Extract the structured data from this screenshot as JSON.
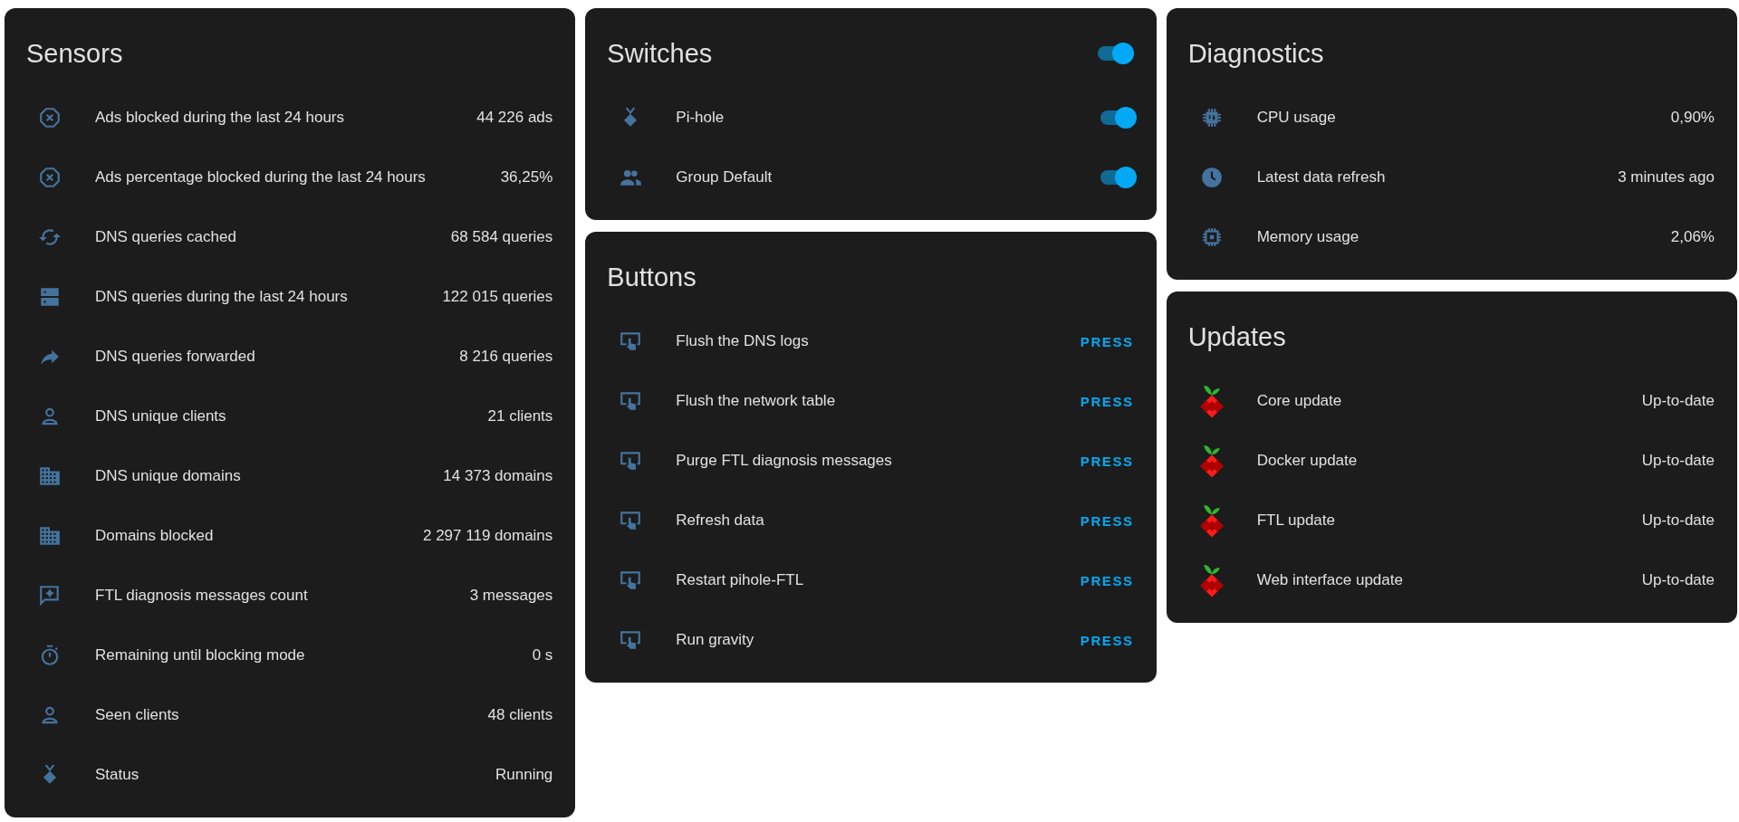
{
  "sensors": {
    "title": "Sensors",
    "rows": [
      {
        "label": "Ads blocked during the last 24 hours",
        "value": "44 226 ads"
      },
      {
        "label": "Ads percentage blocked during the last 24 hours",
        "value": "36,25%"
      },
      {
        "label": "DNS queries cached",
        "value": "68 584 queries"
      },
      {
        "label": "DNS queries during the last 24 hours",
        "value": "122 015 queries"
      },
      {
        "label": "DNS queries forwarded",
        "value": "8 216 queries"
      },
      {
        "label": "DNS unique clients",
        "value": "21 clients"
      },
      {
        "label": "DNS unique domains",
        "value": "14 373 domains"
      },
      {
        "label": "Domains blocked",
        "value": "2 297 119 domains"
      },
      {
        "label": "FTL diagnosis messages count",
        "value": "3 messages"
      },
      {
        "label": "Remaining until blocking mode",
        "value": "0 s"
      },
      {
        "label": "Seen clients",
        "value": "48 clients"
      },
      {
        "label": "Status",
        "value": "Running"
      }
    ]
  },
  "switches": {
    "title": "Switches",
    "on": true,
    "rows": [
      {
        "label": "Pi-hole",
        "on": true
      },
      {
        "label": "Group Default",
        "on": true
      }
    ]
  },
  "buttons": {
    "title": "Buttons",
    "rows": [
      {
        "label": "Flush the DNS logs",
        "action": "PRESS"
      },
      {
        "label": "Flush the network table",
        "action": "PRESS"
      },
      {
        "label": "Purge FTL diagnosis messages",
        "action": "PRESS"
      },
      {
        "label": "Refresh data",
        "action": "PRESS"
      },
      {
        "label": "Restart pihole-FTL",
        "action": "PRESS"
      },
      {
        "label": "Run gravity",
        "action": "PRESS"
      }
    ]
  },
  "diagnostics": {
    "title": "Diagnostics",
    "rows": [
      {
        "label": "CPU usage",
        "value": "0,90%"
      },
      {
        "label": "Latest data refresh",
        "value": "3 minutes ago"
      },
      {
        "label": "Memory usage",
        "value": "2,06%"
      }
    ]
  },
  "updates": {
    "title": "Updates",
    "rows": [
      {
        "label": "Core update",
        "value": "Up-to-date"
      },
      {
        "label": "Docker update",
        "value": "Up-to-date"
      },
      {
        "label": "FTL update",
        "value": "Up-to-date"
      },
      {
        "label": "Web interface update",
        "value": "Up-to-date"
      }
    ]
  }
}
